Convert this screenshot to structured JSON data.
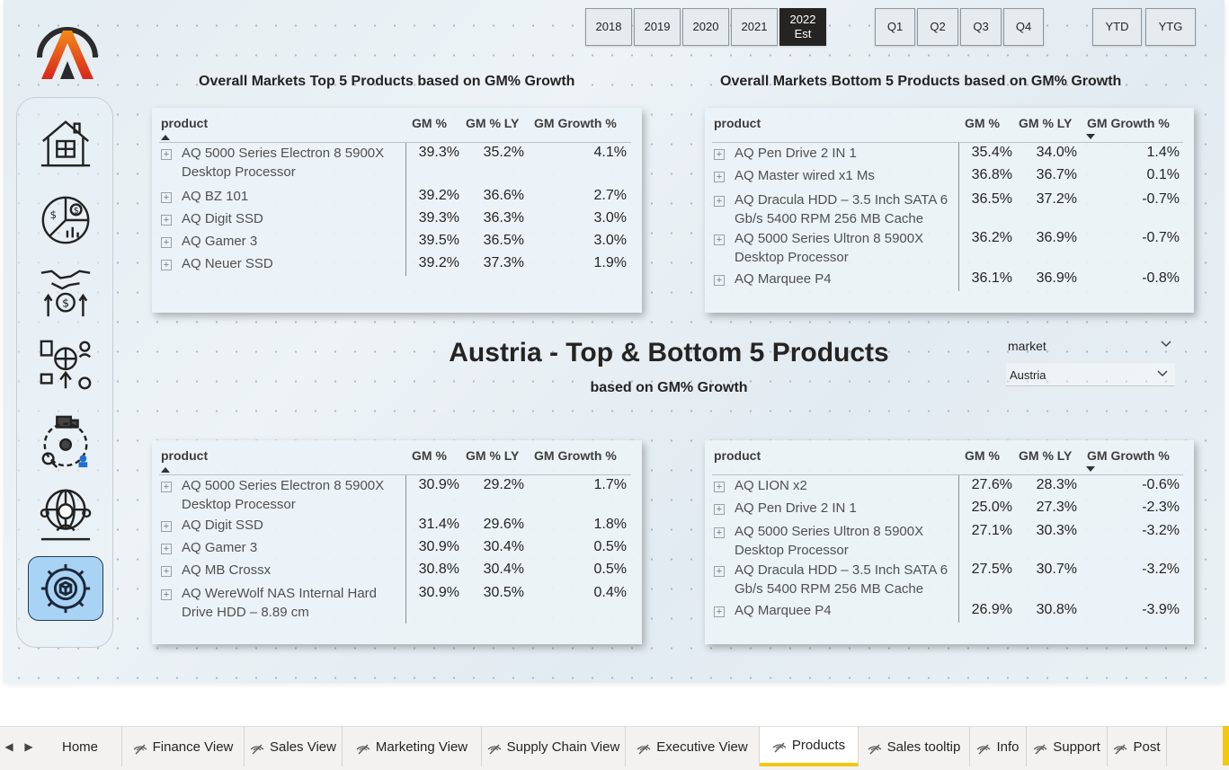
{
  "period": {
    "years": [
      "2018",
      "2019",
      "2020",
      "2021"
    ],
    "selected_year": {
      "line1": "2022",
      "line2": "Est"
    },
    "quarters": [
      "Q1",
      "Q2",
      "Q3",
      "Q4"
    ],
    "ytd": "YTD",
    "ytg": "YTG"
  },
  "titles": {
    "top_left": "Overall Markets Top 5 Products based on GM% Growth",
    "top_right": "Overall Markets Bottom 5 Products based on GM% Growth",
    "main": "Austria - Top & Bottom 5 Products",
    "sub": "based on GM% Growth"
  },
  "slicer": {
    "label": "market",
    "value": "Austria"
  },
  "columns": {
    "product": "product",
    "gm": "GM %",
    "gm_ly": "GM % LY",
    "growth": "GM Growth %"
  },
  "tables": {
    "overall_top": [
      {
        "product": "AQ 5000 Series Electron 8 5900X Desktop Processor",
        "gm": "39.3%",
        "gm_ly": "35.2%",
        "growth": "4.1%"
      },
      {
        "product": "AQ BZ 101",
        "gm": "39.2%",
        "gm_ly": "36.6%",
        "growth": "2.7%"
      },
      {
        "product": "AQ Digit SSD",
        "gm": "39.3%",
        "gm_ly": "36.3%",
        "growth": "3.0%"
      },
      {
        "product": "AQ Gamer 3",
        "gm": "39.5%",
        "gm_ly": "36.5%",
        "growth": "3.0%"
      },
      {
        "product": "AQ Neuer SSD",
        "gm": "39.2%",
        "gm_ly": "37.3%",
        "growth": "1.9%"
      }
    ],
    "overall_bottom": [
      {
        "product": "AQ Pen Drive 2 IN 1",
        "gm": "35.4%",
        "gm_ly": "34.0%",
        "growth": "1.4%"
      },
      {
        "product": "AQ Master wired x1 Ms",
        "gm": "36.8%",
        "gm_ly": "36.7%",
        "growth": "0.1%"
      },
      {
        "product": "AQ Dracula HDD – 3.5 Inch SATA 6 Gb/s 5400 RPM 256 MB Cache",
        "gm": "36.5%",
        "gm_ly": "37.2%",
        "growth": "-0.7%"
      },
      {
        "product": "AQ 5000 Series Ultron 8 5900X Desktop Processor",
        "gm": "36.2%",
        "gm_ly": "36.9%",
        "growth": "-0.7%"
      },
      {
        "product": "AQ Marquee P4",
        "gm": "36.1%",
        "gm_ly": "36.9%",
        "growth": "-0.8%"
      }
    ],
    "austria_top": [
      {
        "product": "AQ 5000 Series Electron 8 5900X Desktop Processor",
        "gm": "30.9%",
        "gm_ly": "29.2%",
        "growth": "1.7%"
      },
      {
        "product": "AQ Digit SSD",
        "gm": "31.4%",
        "gm_ly": "29.6%",
        "growth": "1.8%"
      },
      {
        "product": "AQ Gamer 3",
        "gm": "30.9%",
        "gm_ly": "30.4%",
        "growth": "0.5%"
      },
      {
        "product": "AQ MB Crossx",
        "gm": "30.8%",
        "gm_ly": "30.4%",
        "growth": "0.5%"
      },
      {
        "product": "AQ WereWolf NAS Internal Hard Drive HDD – 8.89 cm",
        "gm": "30.9%",
        "gm_ly": "30.5%",
        "growth": "0.4%"
      }
    ],
    "austria_bottom": [
      {
        "product": "AQ LION x2",
        "gm": "27.6%",
        "gm_ly": "28.3%",
        "growth": "-0.6%"
      },
      {
        "product": "AQ Pen Drive 2 IN 1",
        "gm": "25.0%",
        "gm_ly": "27.3%",
        "growth": "-2.3%"
      },
      {
        "product": "AQ 5000 Series Ultron 8 5900X Desktop Processor",
        "gm": "27.1%",
        "gm_ly": "30.3%",
        "growth": "-3.2%"
      },
      {
        "product": "AQ Dracula HDD – 3.5 Inch SATA 6 Gb/s 5400 RPM 256 MB Cache",
        "gm": "27.5%",
        "gm_ly": "30.7%",
        "growth": "-3.2%"
      },
      {
        "product": "AQ Marquee P4",
        "gm": "26.9%",
        "gm_ly": "30.8%",
        "growth": "-3.9%"
      }
    ]
  },
  "nav": {
    "icons": [
      "home-building-icon",
      "finance-pie-chart-icon",
      "sales-handshake-icon",
      "marketing-network-icon",
      "supply-chain-icon",
      "executive-globe-icon",
      "products-gear-icon"
    ]
  },
  "tabs": {
    "items": [
      {
        "label": "Home",
        "hidden": false
      },
      {
        "label": "Finance View",
        "hidden": true
      },
      {
        "label": "Sales View",
        "hidden": true
      },
      {
        "label": "Marketing View",
        "hidden": true
      },
      {
        "label": "Supply Chain View",
        "hidden": true
      },
      {
        "label": "Executive View",
        "hidden": true
      },
      {
        "label": "Products",
        "hidden": true
      },
      {
        "label": "Sales tooltip",
        "hidden": true
      },
      {
        "label": "Info",
        "hidden": true
      },
      {
        "label": "Support",
        "hidden": true
      },
      {
        "label": "Post",
        "hidden": true
      }
    ],
    "active": "Products"
  },
  "colors": {
    "accent_yellow": "#f2c811",
    "selected_dark": "#252423",
    "active_nav": "#a9d3f5",
    "logo_orange": "#e8501c"
  }
}
